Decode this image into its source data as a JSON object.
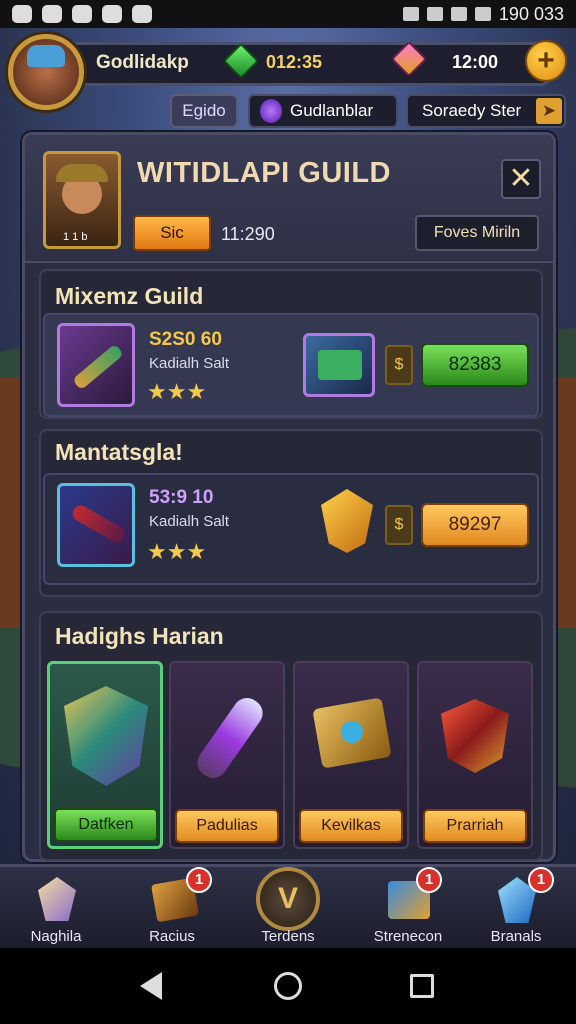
{
  "status_bar": {
    "time": "190 033"
  },
  "hud": {
    "player_name": "Godlidakp",
    "resource1": "012:35",
    "resource2": "12:00",
    "plus_label": "+"
  },
  "subtabs": {
    "tab1": "Egido",
    "tab2": "Gudlanblar",
    "tab3": "Soraedy Ster"
  },
  "guild_panel": {
    "title": "WITIDLAPI GUILD",
    "close_label": "✕",
    "hero_tag": "1 1 b",
    "sic_button": "Sic",
    "header_value": "11:290",
    "foves_button": "Foves Miriln"
  },
  "section1": {
    "title": "Mixemz Guild",
    "value": "S2S0 60",
    "sub": "Kadialh Salt",
    "stars": "★★★",
    "small_btn": "$",
    "action_button": "82383",
    "colors": {
      "button": "#3fa52a"
    }
  },
  "section2": {
    "title": "Mantatsgla!",
    "value": "53:9 10",
    "sub": "Kadialh Salt",
    "stars": "★★★",
    "small_btn": "$",
    "action_button": "89297",
    "colors": {
      "button": "#f2a93a"
    }
  },
  "section3": {
    "title": "Hadighs Harian",
    "cards": [
      {
        "label": "Datfken",
        "icon": "shield-emerald-icon"
      },
      {
        "label": "Padulias",
        "icon": "scepter-orb-icon"
      },
      {
        "label": "Kevilkas",
        "icon": "treasure-box-icon"
      },
      {
        "label": "Prarriah",
        "icon": "ruby-shield-icon"
      }
    ]
  },
  "bottom_nav": [
    {
      "label": "Naghila",
      "icon": "crystal-icon",
      "badge": ""
    },
    {
      "label": "Racius",
      "icon": "scroll-icon",
      "badge": "1"
    },
    {
      "label": "Terdens",
      "icon": "emblem-icon",
      "badge": ""
    },
    {
      "label": "Strenecon",
      "icon": "chest-icon",
      "badge": "1"
    },
    {
      "label": "Branals",
      "icon": "diamond-icon",
      "badge": "1"
    }
  ]
}
